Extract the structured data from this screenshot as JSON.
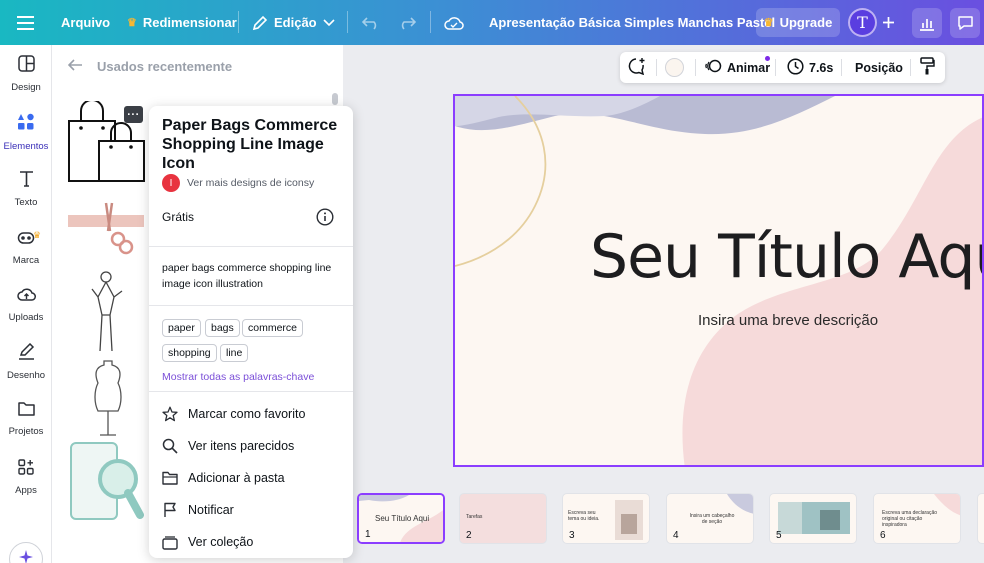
{
  "topbar": {
    "file_label": "Arquivo",
    "resize_label": "Redimensionar",
    "edit_label": "Edição",
    "doc_title": "Apresentação Básica Simples Manchas Pastel",
    "upgrade_label": "Upgrade",
    "avatar_letter": "T",
    "menu_icon": "hamburger-icon",
    "undo_icon": "undo-icon",
    "redo_icon": "redo-icon",
    "cloud_icon": "cloud-save-icon"
  },
  "leftnav": {
    "items": [
      {
        "label": "Design",
        "icon": "layout-icon"
      },
      {
        "label": "Elementos",
        "icon": "elements-icon"
      },
      {
        "label": "Texto",
        "icon": "text-icon"
      },
      {
        "label": "Marca",
        "icon": "brand-icon"
      },
      {
        "label": "Uploads",
        "icon": "upload-icon"
      },
      {
        "label": "Desenho",
        "icon": "draw-icon"
      },
      {
        "label": "Projetos",
        "icon": "folder-icon"
      },
      {
        "label": "Apps",
        "icon": "apps-icon"
      }
    ],
    "active": "Elementos"
  },
  "sidepanel": {
    "header": "Usados recentemente"
  },
  "popup": {
    "title": "Paper Bags Commerce Shopping Line Image Icon",
    "author_initial": "I",
    "author_link": "Ver mais designs de iconsy",
    "price": "Grátis",
    "description": "paper bags commerce shopping line image icon illustration",
    "tags": [
      "paper",
      "bags",
      "commerce",
      "shopping",
      "line"
    ],
    "keywords_link": "Mostrar todas as palavras-chave",
    "menu": [
      {
        "label": "Marcar como favorito",
        "icon": "star-icon"
      },
      {
        "label": "Ver itens parecidos",
        "icon": "search-icon"
      },
      {
        "label": "Adicionar à pasta",
        "icon": "folder-icon"
      },
      {
        "label": "Notificar",
        "icon": "flag-icon"
      },
      {
        "label": "Ver coleção",
        "icon": "collection-icon"
      }
    ],
    "more_label": "···"
  },
  "context_toolbar": {
    "animate_label": "Animar",
    "duration_label": "7.6s",
    "position_label": "Posição",
    "swatch_color": "#fbf5ef"
  },
  "canvas": {
    "title": "Seu Título Aqui",
    "subtitle": "Insira uma breve descrição"
  },
  "filmstrip": {
    "pages": [
      {
        "num": "1",
        "text": "Seu Título Aqui"
      },
      {
        "num": "2",
        "text": "Tarefas"
      },
      {
        "num": "3",
        "text": "Escreva seu tema ou ideia."
      },
      {
        "num": "4",
        "text": "Insira um cabeçalho de seção"
      },
      {
        "num": "5",
        "text": ""
      },
      {
        "num": "6",
        "text": "Escreva uma declaração original ou citação inspiradora"
      }
    ]
  },
  "colors": {
    "accent": "#8b3dff",
    "canvas_bg": "#fdf7f2",
    "blob_pink": "#f6dada",
    "blob_lavender": "#b9bbd3"
  }
}
